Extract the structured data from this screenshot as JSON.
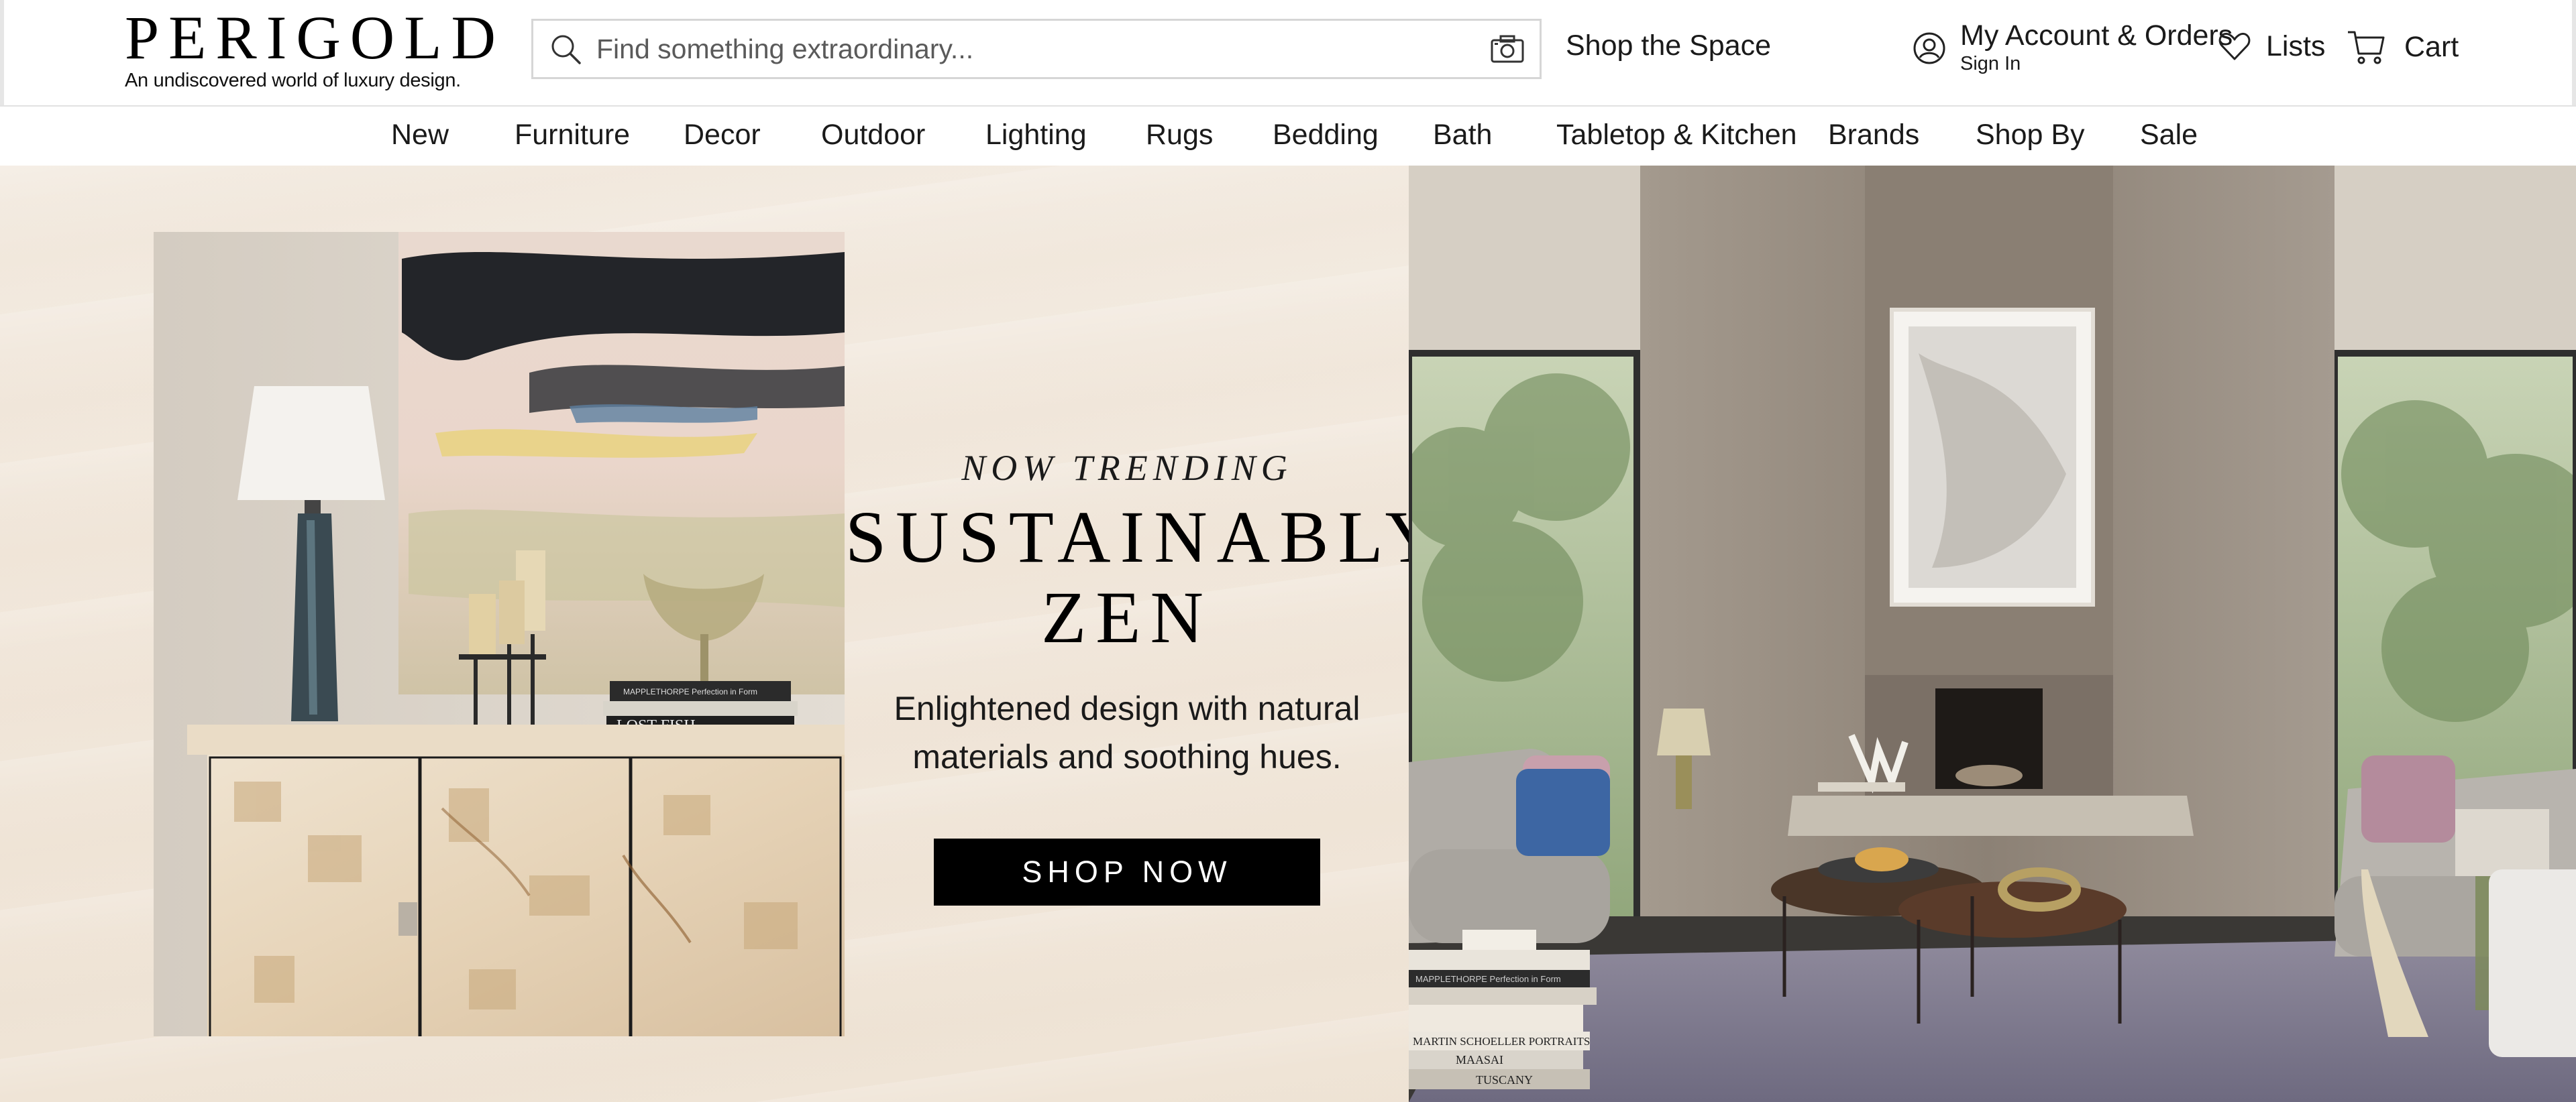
{
  "brand": {
    "name": "PERIGOLD",
    "tagline": "An undiscovered world of luxury design."
  },
  "search": {
    "placeholder": "Find something extraordinary..."
  },
  "header": {
    "shop_space": "Shop the Space",
    "account_label": "My Account & Orders",
    "account_sub": "Sign In",
    "lists_label": "Lists",
    "cart_label": "Cart"
  },
  "nav": {
    "items": [
      "New",
      "Furniture",
      "Decor",
      "Outdoor",
      "Lighting",
      "Rugs",
      "Bedding",
      "Bath",
      "Tabletop & Kitchen",
      "Brands",
      "Shop By",
      "Sale"
    ]
  },
  "hero": {
    "eyebrow": "NOW TRENDING",
    "headline_line1": "SUSTAINABLY",
    "headline_line2": "ZEN",
    "subcopy_line1": "Enlightened design with natural",
    "subcopy_line2": "materials and soothing hues.",
    "cta": "SHOP NOW"
  },
  "vignette_books": {
    "top": "MAPPLETHORPE Perfection in Form",
    "bottom": "LOST FISH"
  },
  "room_books": {
    "spines": [
      "MAPPLETHORPE Perfection in Form",
      "MARTIN SCHOELLER PORTRAITS",
      "MAASAI",
      "TUSCANY"
    ]
  },
  "colors": {
    "accent": "#000000",
    "hero_bg": "#f1e7db",
    "text": "#1a1a1a"
  },
  "icons": {
    "search": "search-icon",
    "camera": "camera-icon",
    "account": "account-icon",
    "lists": "heart-icon",
    "cart": "cart-icon"
  }
}
